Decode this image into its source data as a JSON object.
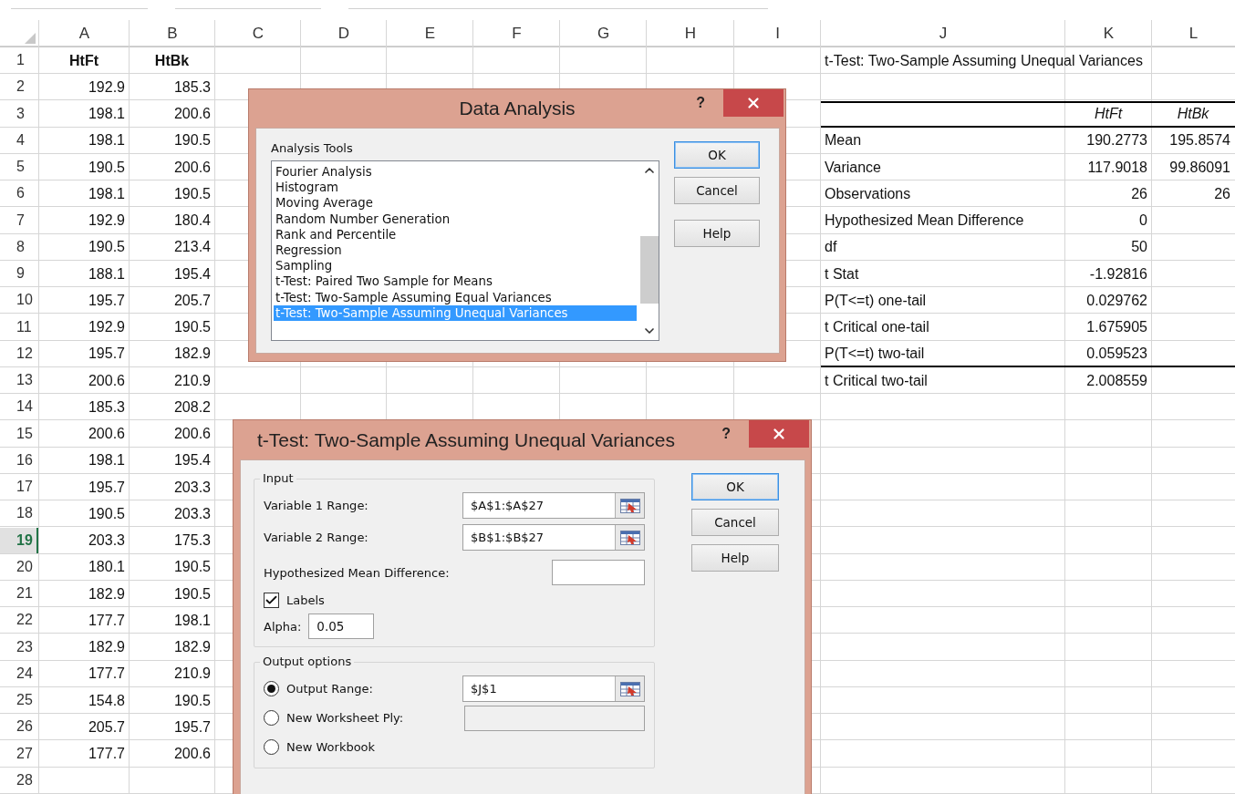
{
  "sheet": {
    "columns": [
      "A",
      "B",
      "C",
      "D",
      "E",
      "F",
      "G",
      "H",
      "I",
      "J",
      "K",
      "L"
    ],
    "rows": [
      {
        "number": "1",
        "selected": false
      },
      {
        "number": "2",
        "selected": false
      },
      {
        "number": "3",
        "selected": false
      },
      {
        "number": "4",
        "selected": false
      },
      {
        "number": "5",
        "selected": false
      },
      {
        "number": "6",
        "selected": false
      },
      {
        "number": "7",
        "selected": false
      },
      {
        "number": "8",
        "selected": false
      },
      {
        "number": "9",
        "selected": false
      },
      {
        "number": "10",
        "selected": false
      },
      {
        "number": "11",
        "selected": false
      },
      {
        "number": "12",
        "selected": false
      },
      {
        "number": "13",
        "selected": false
      },
      {
        "number": "14",
        "selected": false
      },
      {
        "number": "15",
        "selected": false
      },
      {
        "number": "16",
        "selected": false
      },
      {
        "number": "17",
        "selected": false
      },
      {
        "number": "18",
        "selected": false
      },
      {
        "number": "19",
        "selected": true
      },
      {
        "number": "20",
        "selected": false
      },
      {
        "number": "21",
        "selected": false
      },
      {
        "number": "22",
        "selected": false
      },
      {
        "number": "23",
        "selected": false
      },
      {
        "number": "24",
        "selected": false
      },
      {
        "number": "25",
        "selected": false
      },
      {
        "number": "26",
        "selected": false
      },
      {
        "number": "27",
        "selected": false
      },
      {
        "number": "28",
        "selected": false
      }
    ],
    "data": {
      "header": [
        "HtFt",
        "HtBk"
      ],
      "rows": [
        [
          "192.9",
          "185.3"
        ],
        [
          "198.1",
          "200.6"
        ],
        [
          "198.1",
          "190.5"
        ],
        [
          "190.5",
          "200.6"
        ],
        [
          "198.1",
          "190.5"
        ],
        [
          "192.9",
          "180.4"
        ],
        [
          "190.5",
          "213.4"
        ],
        [
          "188.1",
          "195.4"
        ],
        [
          "195.7",
          "205.7"
        ],
        [
          "192.9",
          "190.5"
        ],
        [
          "195.7",
          "182.9"
        ],
        [
          "200.6",
          "210.9"
        ],
        [
          "185.3",
          "208.2"
        ],
        [
          "200.6",
          "200.6"
        ],
        [
          "198.1",
          "195.4"
        ],
        [
          "195.7",
          "203.3"
        ],
        [
          "190.5",
          "203.3"
        ],
        [
          "203.3",
          "175.3"
        ],
        [
          "180.1",
          "190.5"
        ],
        [
          "182.9",
          "190.5"
        ],
        [
          "177.7",
          "198.1"
        ],
        [
          "182.9",
          "182.9"
        ],
        [
          "177.7",
          "210.9"
        ],
        [
          "154.8",
          "190.5"
        ],
        [
          "205.7",
          "195.7"
        ],
        [
          "177.7",
          "200.6"
        ]
      ]
    },
    "output": {
      "title": "t-Test: Two-Sample Assuming Unequal Variances",
      "header": [
        "HtFt",
        "HtBk"
      ],
      "stats": [
        {
          "label": "Mean",
          "values": [
            "190.2773",
            "195.8574"
          ]
        },
        {
          "label": "Variance",
          "values": [
            "117.9018",
            "99.86091"
          ]
        },
        {
          "label": "Observations",
          "values": [
            "26",
            "26"
          ]
        },
        {
          "label": "Hypothesized Mean Difference",
          "values": [
            "0"
          ]
        },
        {
          "label": "df",
          "values": [
            "50"
          ]
        },
        {
          "label": "t Stat",
          "values": [
            "-1.92816"
          ]
        },
        {
          "label": "P(T<=t) one-tail",
          "values": [
            "0.029762"
          ]
        },
        {
          "label": "t Critical one-tail",
          "values": [
            "1.675905"
          ]
        },
        {
          "label": "P(T<=t) two-tail",
          "values": [
            "0.059523"
          ]
        },
        {
          "label": "t Critical two-tail",
          "values": [
            "2.008559"
          ]
        }
      ]
    }
  },
  "data_analysis_dialog": {
    "title": "Data Analysis",
    "help": "?",
    "list_label": "Analysis Tools",
    "tools": [
      {
        "label": "Fourier Analysis",
        "selected": false
      },
      {
        "label": "Histogram",
        "selected": false
      },
      {
        "label": "Moving Average",
        "selected": false
      },
      {
        "label": "Random Number Generation",
        "selected": false
      },
      {
        "label": "Rank and Percentile",
        "selected": false
      },
      {
        "label": "Regression",
        "selected": false
      },
      {
        "label": "Sampling",
        "selected": false
      },
      {
        "label": "t-Test: Paired Two Sample for Means",
        "selected": false
      },
      {
        "label": "t-Test: Two-Sample Assuming Equal Variances",
        "selected": false
      },
      {
        "label": "t-Test: Two-Sample Assuming Unequal Variances",
        "selected": true
      }
    ],
    "buttons": [
      {
        "label": "OK",
        "default": true
      },
      {
        "label": "Cancel",
        "default": false
      },
      {
        "label": "Help",
        "default": false
      }
    ]
  },
  "ttest_dialog": {
    "title": "t-Test: Two-Sample Assuming Unequal Variances",
    "help": "?",
    "input": {
      "legend": "Input",
      "variable_1": {
        "label": "Variable 1 Range:",
        "value": "$A$1:$A$27"
      },
      "variable_2": {
        "label": "Variable 2 Range:",
        "value": "$B$1:$B$27"
      },
      "mean_difference": {
        "label": "Hypothesized Mean Difference:"
      },
      "labels": {
        "label": "Labels",
        "checked": true
      },
      "alpha": {
        "label": "Alpha:",
        "value": "0.05"
      }
    },
    "output": {
      "legend": "Output options",
      "options": [
        {
          "label": "Output Range:",
          "selected": true,
          "value": "$J$1",
          "disabled": false
        },
        {
          "label": "New Worksheet Ply:",
          "selected": false,
          "disabled": true
        },
        {
          "label": "New Workbook",
          "selected": false
        }
      ]
    },
    "buttons": [
      {
        "label": "OK",
        "default": true
      },
      {
        "label": "Cancel",
        "default": false
      },
      {
        "label": "Help",
        "default": false
      }
    ]
  }
}
